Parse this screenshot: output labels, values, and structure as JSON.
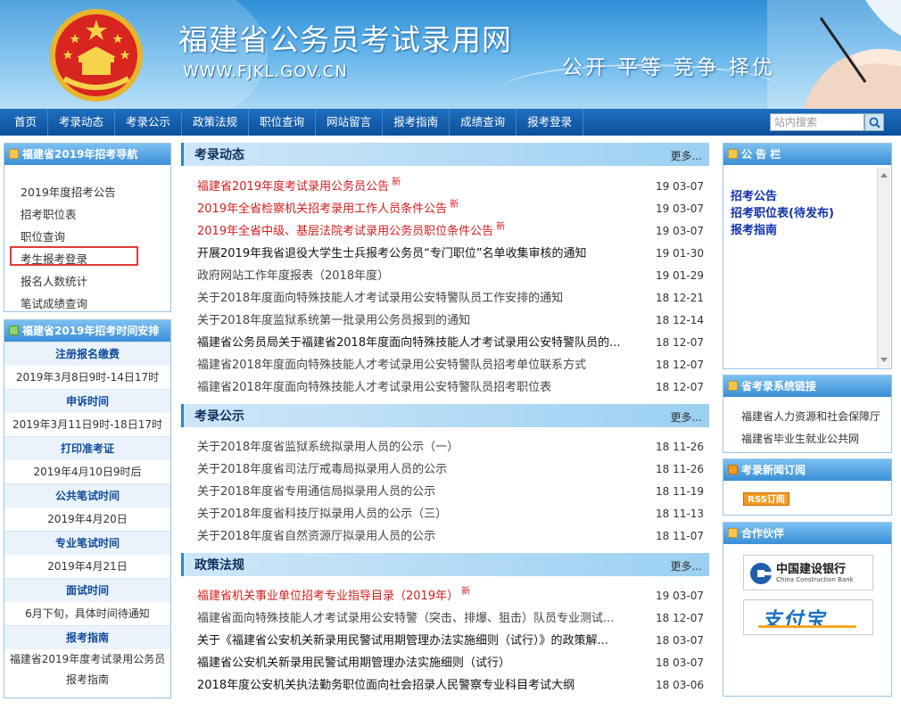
{
  "header": {
    "site_title": "福建省公务员考试录用网",
    "site_url": "WWW.FJKL.GOV.CN",
    "slogan": "公开 平等 竞争 择优"
  },
  "nav": {
    "items": [
      "首页",
      "考录动态",
      "考录公示",
      "政策法规",
      "职位查询",
      "网站留言",
      "报考指南",
      "成绩查询",
      "报考登录"
    ],
    "search_placeholder": "站内搜索"
  },
  "left": {
    "nav_title": "福建省2019年招考导航",
    "nav_items": [
      "2019年度招考公告",
      "招考职位表",
      "职位查询",
      "考生报考登录",
      "报名人数统计",
      "笔试成绩查询"
    ],
    "highlighted_item": "考生报考登录",
    "schedule_title": "福建省2019年招考时间安排",
    "schedule": [
      {
        "label": "注册报名缴费",
        "value": "2019年3月8日9时-14日17时"
      },
      {
        "label": "申诉时间",
        "value": "2019年3月11日9时-18日17时"
      },
      {
        "label": "打印准考证",
        "value": "2019年4月10日9时后"
      },
      {
        "label": "公共笔试时间",
        "value": "2019年4月20日"
      },
      {
        "label": "专业笔试时间",
        "value": "2019年4月21日"
      },
      {
        "label": "面试时间",
        "value": "6月下旬，具体时间待通知"
      },
      {
        "label": "报考指南",
        "value": "福建省2019年度考试录用公务员报考指南"
      }
    ]
  },
  "sections": [
    {
      "title": "考录动态",
      "more": "更多...",
      "rows": [
        {
          "title": "福建省2019年度考试录用公务员公告",
          "date": "19 03-07",
          "style": "red",
          "new": "新"
        },
        {
          "title": "2019年全省检察机关招考录用工作人员条件公告",
          "date": "19 03-07",
          "style": "red",
          "new": "新"
        },
        {
          "title": "2019年全省中级、基层法院考试录用公务员职位条件公告",
          "date": "19 03-07",
          "style": "red",
          "new": "新"
        },
        {
          "title": "开展2019年我省退役大学生士兵报考公务员“专门职位”名单收集审核的通知",
          "date": "19 01-30",
          "style": "black",
          "new": ""
        },
        {
          "title": "政府网站工作年度报表（2018年度）",
          "date": "19 01-29",
          "style": "gray",
          "new": ""
        },
        {
          "title": "关于2018年度面向特殊技能人才考试录用公安特警队员工作安排的通知",
          "date": "18 12-21",
          "style": "gray",
          "new": ""
        },
        {
          "title": "关于2018年度监狱系统第一批录用公务员报到的通知",
          "date": "18 12-14",
          "style": "gray",
          "new": ""
        },
        {
          "title": "福建省公务员局关于福建省2018年度面向特殊技能人才考试录用公安特警队员的...",
          "date": "18 12-07",
          "style": "black",
          "new": ""
        },
        {
          "title": "福建省2018年度面向特殊技能人才考试录用公安特警队员招考单位联系方式",
          "date": "18 12-07",
          "style": "gray",
          "new": ""
        },
        {
          "title": "福建省2018年度面向特殊技能人才考试录用公安特警队员招考职位表",
          "date": "18 12-07",
          "style": "gray",
          "new": ""
        }
      ]
    },
    {
      "title": "考录公示",
      "more": "更多...",
      "rows": [
        {
          "title": "关于2018年度省监狱系统拟录用人员的公示（一）",
          "date": "18 11-26",
          "style": "gray",
          "new": ""
        },
        {
          "title": "关于2018年度省司法厅戒毒局拟录用人员的公示",
          "date": "18 11-26",
          "style": "gray",
          "new": ""
        },
        {
          "title": "关于2018年度省专用通信局拟录用人员的公示",
          "date": "18 11-19",
          "style": "gray",
          "new": ""
        },
        {
          "title": "关于2018年度省科技厅拟录用人员的公示（三）",
          "date": "18 11-13",
          "style": "gray",
          "new": ""
        },
        {
          "title": "关于2018年度省自然资源厅拟录用人员的公示",
          "date": "18 11-07",
          "style": "gray",
          "new": ""
        }
      ]
    },
    {
      "title": "政策法规",
      "more": "更多...",
      "rows": [
        {
          "title": "福建省机关事业单位招考专业指导目录（2019年）",
          "date": "19 03-07",
          "style": "red",
          "new": "新"
        },
        {
          "title": "福建省面向特殊技能人才考试录用公安特警（突击、排爆、狙击）队员专业测试...",
          "date": "18 12-07",
          "style": "gray",
          "new": ""
        },
        {
          "title": "关于《福建省公安机关新录用民警试用期管理办法实施细则（试行）》的政策解...",
          "date": "18 03-07",
          "style": "black",
          "new": ""
        },
        {
          "title": "福建省公安机关新录用民警试用期管理办法实施细则（试行）",
          "date": "18 03-07",
          "style": "black",
          "new": ""
        },
        {
          "title": "2018年度公安机关执法勤务职位面向社会招录人民警察专业科目考试大纲",
          "date": "18 03-06",
          "style": "black",
          "new": ""
        }
      ]
    }
  ],
  "right": {
    "bulletin_title": "公 告 栏",
    "bulletin_links": [
      "招考公告",
      "招考职位表(待发布)",
      "报考指南"
    ],
    "links_title": "省考录系统链接",
    "links": [
      "福建省人力资源和社会保障厅",
      "福建省毕业生就业公共网"
    ],
    "rss_title": "考录新闻订阅",
    "rss_label": "RSS订阅",
    "partners_title": "合作伙伴",
    "ccb_cn": "中国建设银行",
    "ccb_en": "China Construction Bank",
    "alipay": "支付宝"
  },
  "colors": {
    "nav": "#0d4f9a",
    "red_link": "#d31e1e",
    "bulletin_link": "#1131a8",
    "highlight": "#e23b3b"
  }
}
